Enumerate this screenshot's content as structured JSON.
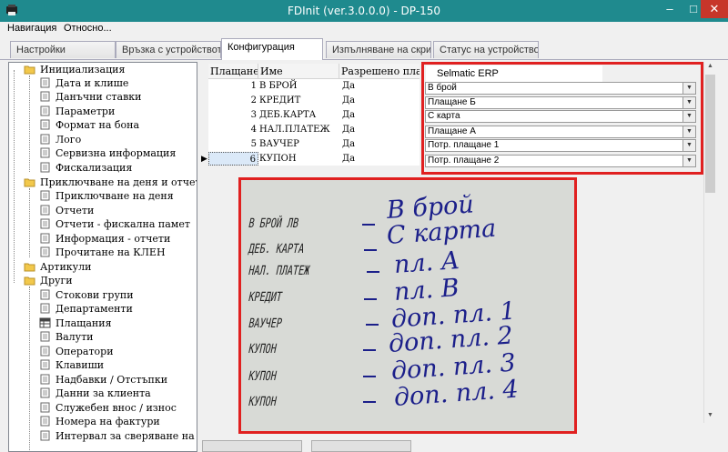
{
  "window": {
    "title": "FDInit (ver.3.0.0.0) - DP-150",
    "minimize_glyph": "–",
    "maximize_glyph": "□",
    "close_glyph": "✕"
  },
  "menu": {
    "items": [
      "Навигация",
      "Относно..."
    ]
  },
  "tabs": [
    {
      "label": "Настройки"
    },
    {
      "label": "Връзка с устройството"
    },
    {
      "label": "Конфигурация",
      "active": true
    },
    {
      "label": "Изпълняване на скрипт"
    },
    {
      "label": "Статус на устройството"
    }
  ],
  "tree": {
    "nodes": [
      {
        "label": "Инициализация",
        "level": 0,
        "icon": "folder-icon"
      },
      {
        "label": "Дата и клише",
        "level": 1,
        "icon": "document-icon"
      },
      {
        "label": "Данъчни ставки",
        "level": 1,
        "icon": "document-icon"
      },
      {
        "label": "Параметри",
        "level": 1,
        "icon": "document-icon"
      },
      {
        "label": "Формат на бона",
        "level": 1,
        "icon": "document-icon"
      },
      {
        "label": "Лого",
        "level": 1,
        "icon": "document-icon"
      },
      {
        "label": "Сервизна информация",
        "level": 1,
        "icon": "document-icon"
      },
      {
        "label": "Фискализация",
        "level": 1,
        "icon": "document-icon"
      },
      {
        "label": "Приключване на деня и отчети",
        "level": 0,
        "icon": "folder-icon"
      },
      {
        "label": "Приключване на деня",
        "level": 1,
        "icon": "document-icon"
      },
      {
        "label": "Отчети",
        "level": 1,
        "icon": "document-icon"
      },
      {
        "label": "Отчети - фискална памет",
        "level": 1,
        "icon": "document-icon"
      },
      {
        "label": "Информация - отчети",
        "level": 1,
        "icon": "document-icon"
      },
      {
        "label": "Прочитане на КЛЕН",
        "level": 1,
        "icon": "document-icon"
      },
      {
        "label": "Артикули",
        "level": 0,
        "icon": "folder-icon"
      },
      {
        "label": "Други",
        "level": 0,
        "icon": "folder-icon"
      },
      {
        "label": "Стокови групи",
        "level": 1,
        "icon": "document-icon"
      },
      {
        "label": "Департаменти",
        "level": 1,
        "icon": "document-icon"
      },
      {
        "label": "Плащания",
        "level": 1,
        "icon": "grid-icon"
      },
      {
        "label": "Валути",
        "level": 1,
        "icon": "document-icon"
      },
      {
        "label": "Оператори",
        "level": 1,
        "icon": "document-icon"
      },
      {
        "label": "Клавиши",
        "level": 1,
        "icon": "document-icon"
      },
      {
        "label": "Надбавки / Отстъпки",
        "level": 1,
        "icon": "document-icon"
      },
      {
        "label": "Данни за клиента",
        "level": 1,
        "icon": "document-icon"
      },
      {
        "label": "Служебен внос / износ",
        "level": 1,
        "icon": "document-icon"
      },
      {
        "label": "Номера на фактури",
        "level": 1,
        "icon": "document-icon"
      },
      {
        "label": "Интервал за сверяване на дата",
        "level": 1,
        "icon": "document-icon"
      }
    ]
  },
  "payments_table": {
    "headers": [
      "Плащане",
      "Име",
      "Разрешено плащане"
    ],
    "rows": [
      {
        "num": "1",
        "name": "В БРОЙ",
        "allowed": "Да"
      },
      {
        "num": "2",
        "name": "КРЕДИТ",
        "allowed": "Да"
      },
      {
        "num": "3",
        "name": "ДЕБ.КАРТА",
        "allowed": "Да"
      },
      {
        "num": "4",
        "name": "НАЛ.ПЛАТЕЖ",
        "allowed": "Да"
      },
      {
        "num": "5",
        "name": "ВАУЧЕР",
        "allowed": "Да"
      },
      {
        "num": "6",
        "name": "КУПОН",
        "allowed": "Да",
        "selected": true
      }
    ],
    "row_pointer": "▶"
  },
  "erp_mapping": {
    "title": "Selmatic ERP",
    "selects": [
      "В брой",
      "Плащане Б",
      "С карта",
      "Плащане А",
      "Потр. плащане 1",
      "Потр. плащане 2"
    ],
    "arrow_glyph": "▼"
  },
  "annotation_photo": {
    "rows": [
      {
        "printed": "В БРОЙ ЛВ",
        "written": "В брой"
      },
      {
        "printed": "ДЕБ. КАРТА",
        "written": "С карта"
      },
      {
        "printed": "НАЛ. ПЛАТЕЖ",
        "written": "пл. А"
      },
      {
        "printed": "КРЕДИТ",
        "written": "пл. В"
      },
      {
        "printed": "ВАУЧЕР",
        "written": "доп. пл. 1"
      },
      {
        "printed": "КУПОН",
        "written": "доп. пл. 2"
      },
      {
        "printed": "КУПОН",
        "written": "доп. пл. 3"
      },
      {
        "printed": "КУПОН",
        "written": "доп. пл. 4"
      }
    ]
  },
  "scroll": {
    "up_glyph": "▲",
    "down_glyph": "▼"
  },
  "colors": {
    "titlebar": "#1f8a8e",
    "highlight_border": "#e02020",
    "ink": "#1b1f8a",
    "close_button": "#c7362a"
  }
}
